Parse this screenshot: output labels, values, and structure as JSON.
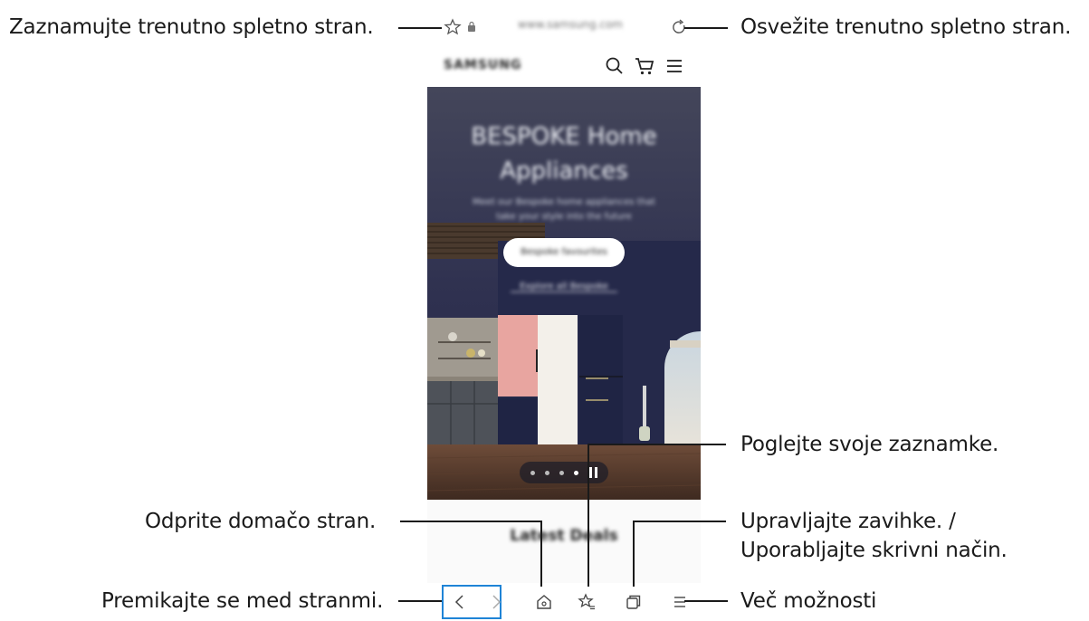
{
  "callouts": {
    "bookmark": "Zaznamujte trenutno spletno stran.",
    "refresh": "Osvežite trenutno spletno stran.",
    "bookmarks_view": "Poglejte svoje zaznamke.",
    "home": "Odprite domačo stran.",
    "tabs_line1": "Upravljajte zavihke. /",
    "tabs_line2": "Uporabljajte skrivni način.",
    "navigate": "Premikajte se med stranmi.",
    "more": "Več možnosti"
  },
  "browser": {
    "url": "www.samsung.com",
    "site_logo": "SAMSUNG",
    "hero_title_line1": "BESPOKE Home",
    "hero_title_line2": "Appliances",
    "hero_subtitle": "Meet our Bespoke home appliances that take your style into the future",
    "hero_button": "Bespoke favourites",
    "hero_link": "Explore all Bespoke",
    "section_title": "Latest Deals",
    "carousel_dots": 5,
    "carousel_active": 4
  },
  "icons": {
    "bookmark": "star-icon",
    "lock": "lock-icon",
    "refresh": "refresh-icon",
    "search": "search-icon",
    "cart": "cart-icon",
    "menu": "menu-icon",
    "back": "chevron-left-icon",
    "forward": "chevron-right-icon",
    "home": "home-icon",
    "bookmarks": "bookmarks-icon",
    "tabs": "tabs-icon",
    "more": "more-menu-icon"
  },
  "colors": {
    "highlight": "#1f84d6",
    "hero_wall": "#2b2f4f",
    "fridge_pink": "#e8a5a0",
    "fridge_navy": "#1f2444"
  }
}
